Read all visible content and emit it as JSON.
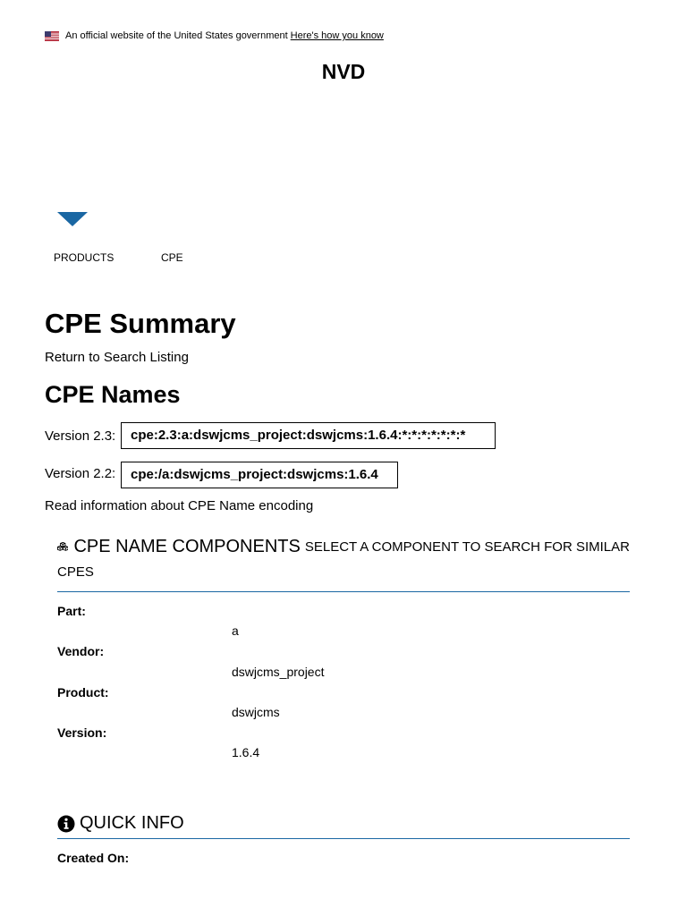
{
  "banner": {
    "text": "An official website of the United States government",
    "link": "Here's how you know"
  },
  "site": {
    "title": "NVD"
  },
  "breadcrumbs": [
    "PRODUCTS",
    "CPE"
  ],
  "page": {
    "title": "CPE Summary",
    "return_link": "Return to Search Listing"
  },
  "cpe_names": {
    "heading": "CPE Names",
    "v23_label": "Version 2.3:",
    "v23_value": "cpe:2.3:a:dswjcms_project:dswjcms:1.6.4:*:*:*:*:*:*:*",
    "v22_label": "Version 2.2:",
    "v22_value": "cpe:/a:dswjcms_project:dswjcms:1.6.4",
    "read_info": "Read information about CPE Name encoding"
  },
  "components": {
    "title": "CPE NAME COMPONENTS",
    "subtitle": "SELECT A COMPONENT TO SEARCH FOR SIMILAR",
    "subtitle_cont": "CPES",
    "fields": [
      {
        "label": "Part:",
        "value": "a"
      },
      {
        "label": "Vendor:",
        "value": "dswjcms_project"
      },
      {
        "label": "Product:",
        "value": "dswjcms"
      },
      {
        "label": "Version:",
        "value": "1.6.4"
      }
    ]
  },
  "quick_info": {
    "title": "QUICK INFO",
    "created_on_label": "Created On:"
  },
  "icons": {
    "flag": "us-flag-icon",
    "menu": "caret-down-icon",
    "components": "cubes-icon",
    "info": "info-circle-icon"
  },
  "colors": {
    "accent": "#1a67a3"
  }
}
